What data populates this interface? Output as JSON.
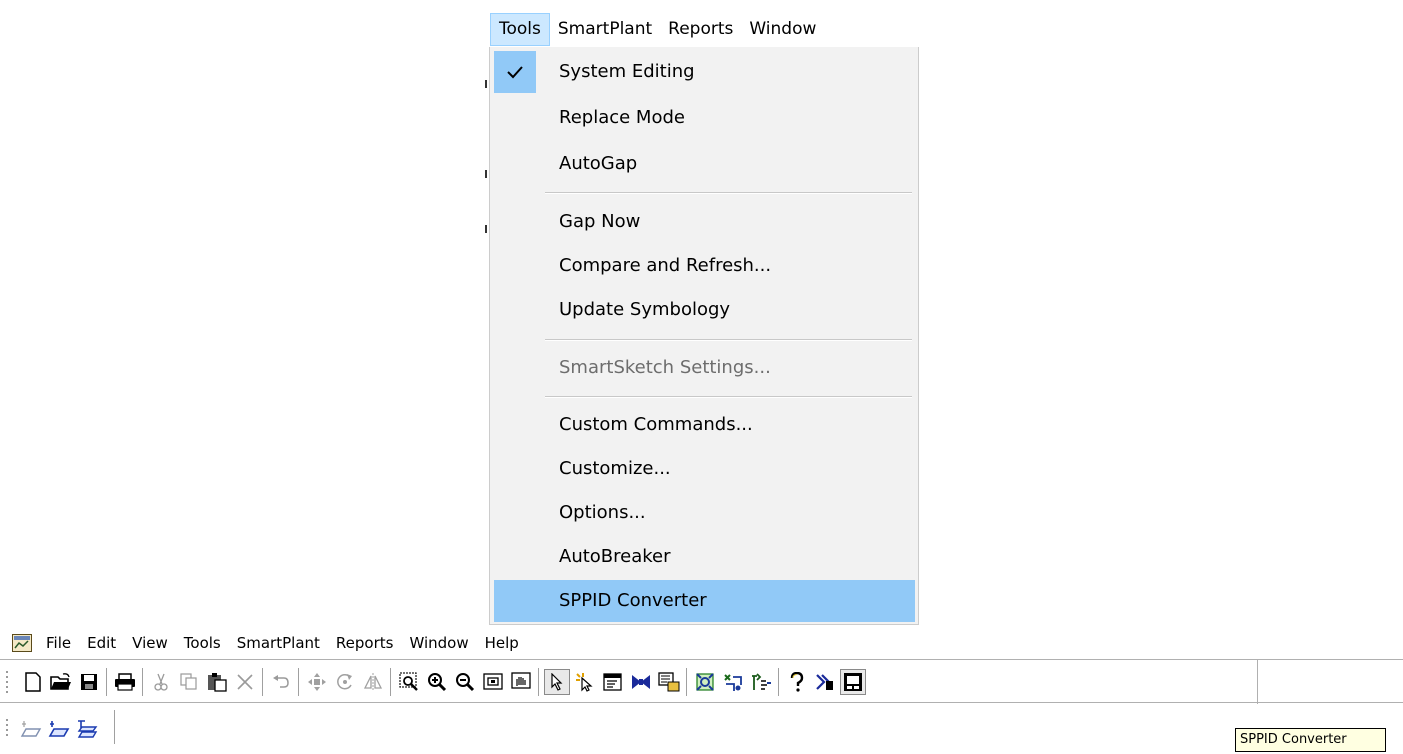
{
  "zoom_menubar": {
    "items": [
      "Tools",
      "SmartPlant",
      "Reports",
      "Window"
    ]
  },
  "tools_menu": {
    "items": [
      {
        "label": "System Editing",
        "checked": true
      },
      {
        "label": "Replace Mode"
      },
      {
        "label": "AutoGap"
      },
      {
        "label": "Gap Now"
      },
      {
        "label": "Compare and Refresh..."
      },
      {
        "label": "Update Symbology"
      },
      {
        "label": "SmartSketch Settings...",
        "disabled": true
      },
      {
        "label": "Custom Commands..."
      },
      {
        "label": "Customize..."
      },
      {
        "label": "Options..."
      },
      {
        "label": "AutoBreaker"
      },
      {
        "label": "SPPID Converter",
        "highlighted": true
      }
    ]
  },
  "app_menubar": {
    "items": [
      "File",
      "Edit",
      "View",
      "Tools",
      "SmartPlant",
      "Reports",
      "Window",
      "Help"
    ]
  },
  "toolbar": {
    "buttons": [
      "new-icon",
      "open-icon",
      "save-icon",
      "print-icon",
      "cut-icon",
      "copy-icon",
      "paste-icon",
      "delete-icon",
      "undo-icon",
      "move-icon",
      "rotate-icon",
      "mirror-icon",
      "zoom-area-icon",
      "zoom-in-icon",
      "zoom-out-icon",
      "fit-icon",
      "pan-icon",
      "select-icon",
      "highlight-select-icon",
      "properties-icon",
      "bowtie-icon",
      "catalog-icon",
      "assign-icon",
      "reconnect-icon",
      "break-icon",
      "help-icon",
      "tool-x-icon",
      "sppid-converter-icon"
    ]
  },
  "toolbar2": {
    "buttons": [
      "layer-hide-icon",
      "layer-show-icon",
      "layer-active-icon"
    ]
  },
  "tooltip": {
    "text": "SPPID Converter"
  }
}
